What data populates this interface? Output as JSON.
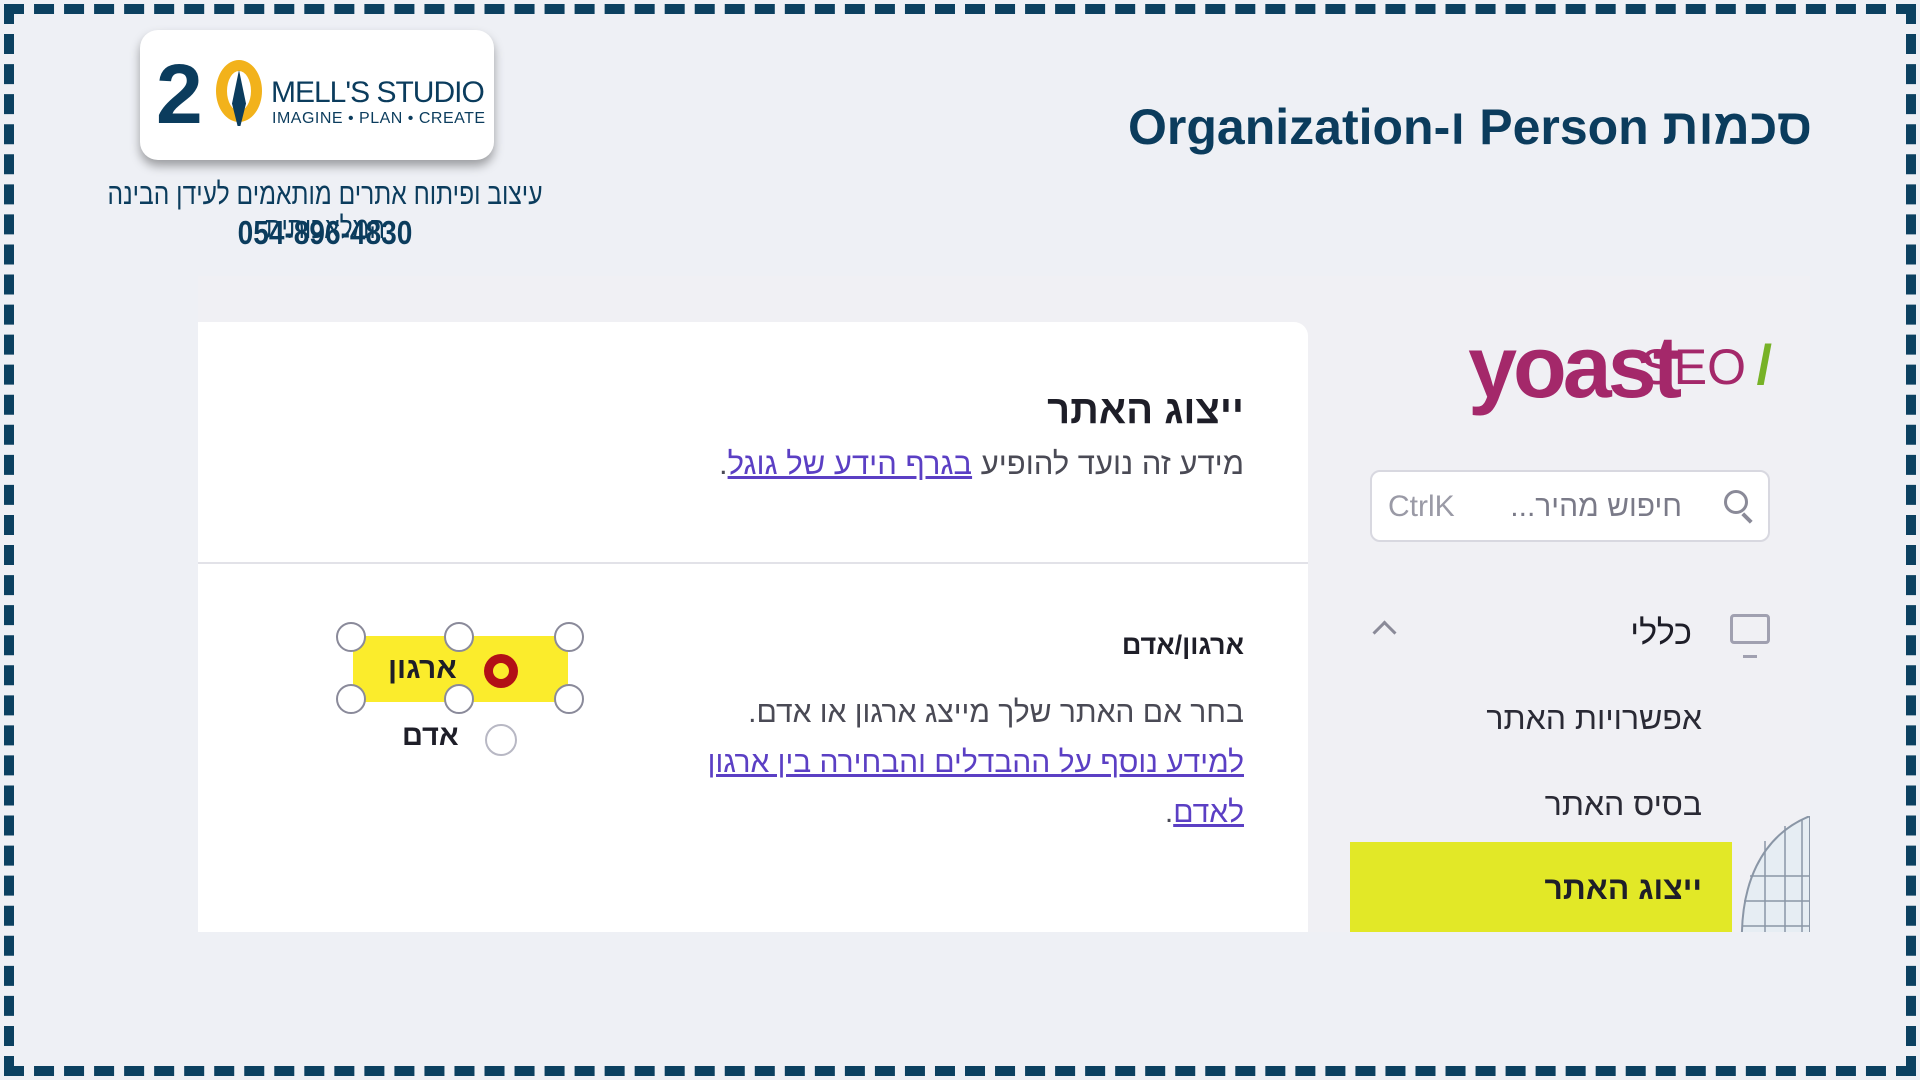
{
  "slide": {
    "title": "סכמות Person ו-Organization"
  },
  "branding": {
    "logo_number": "2",
    "logo_name": "MELL'S STUDIO",
    "logo_tagline": "IMAGINE • PLAN • CREATE",
    "description": "עיצוב ופיתוח אתרים מותאמים לעידן הבינה המלאכותית",
    "phone": "054-896-4830"
  },
  "yoast": {
    "brand": "yoast",
    "seo": "SEO",
    "slash": "/",
    "search_placeholder": "חיפוש מהיר...",
    "search_shortcut": "CtrlK",
    "nav_section": "כללי",
    "nav_items": [
      "אפשרויות האתר",
      "בסיס האתר",
      "ייצוג האתר"
    ],
    "active_item": "ייצוג האתר"
  },
  "card": {
    "title": "ייצוג האתר",
    "subtitle_text": "מידע זה נועד להופיע ",
    "subtitle_link": "בגרף הידע של גוגל",
    "subtitle_end": ".",
    "field_label": "ארגון/אדם",
    "field_desc": "בחר אם האתר שלך מייצג ארגון או אדם.",
    "field_link": "למידע נוסף על ההבדלים והבחירה בין ארגון לאדם",
    "field_link_end": ".",
    "options": [
      {
        "label": "ארגון",
        "selected": true
      },
      {
        "label": "אדם",
        "selected": false
      }
    ]
  },
  "colors": {
    "frame": "#0b4060",
    "yoast_purple": "#a4286a",
    "yoast_green": "#77b227",
    "highlight_yellow": "#fbec2c",
    "link_purple": "#5b3fc4"
  }
}
